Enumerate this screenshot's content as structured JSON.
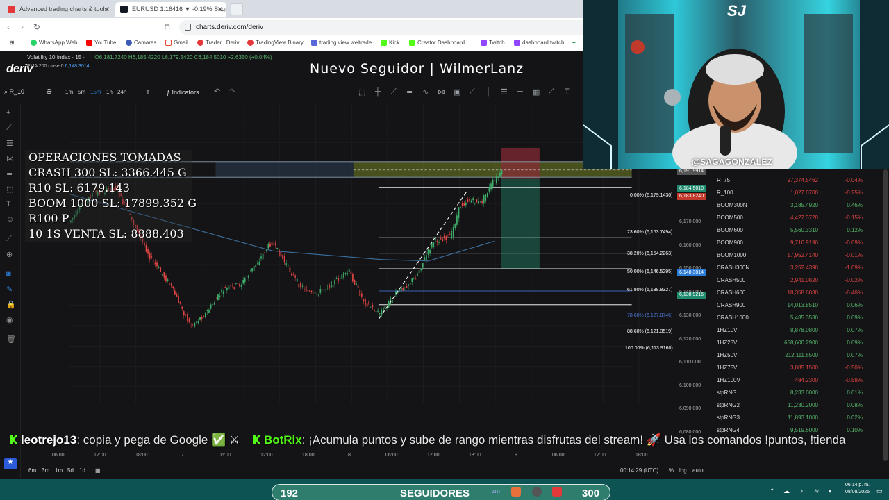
{
  "browser": {
    "tabs": [
      {
        "title": "Advanced trading charts & tools",
        "active": false
      },
      {
        "title": "EURUSD 1.16416 ▼ -0.19% Saga",
        "active": true
      }
    ],
    "url": "charts.deriv.com/deriv",
    "bookmarks": [
      "WhatsApp Web",
      "YouTube",
      "Camaras",
      "Gmail",
      "Trader | Deriv",
      "TradingView Binary",
      "trading view weltrade",
      "Kick",
      "Creator Dashboard |...",
      "Twitch",
      "dashboard twitch"
    ]
  },
  "app": {
    "logo": "deriv",
    "overlay_title": "Nuevo Seguidor | WilmerLanz",
    "symbol": "R_10",
    "timeframes": [
      "1m",
      "5m",
      "15m",
      "1h",
      "24h"
    ],
    "selected_timeframe": "15m",
    "indicators_label": "Indicators",
    "legend_title": "Volatility 10 Index · 15 ·",
    "legend_ohlc": "O6,181.7240 H6,185.4220 L6,179.5420 C6,184.5010 +2.6350 (+0.04%)",
    "legend_ema": "EMA 200 close 0",
    "legend_ema_value": "6,148.3014"
  },
  "operations": {
    "title": "OPERACIONES TOMADAS",
    "lines": [
      "CRASH 300 SL: 3366.445 G",
      "R10 SL: 6179.143",
      "BOOM 1000 SL: 17899.352 G",
      "R100 P",
      "10 1S VENTA SL: 8888.403"
    ]
  },
  "fib_levels": [
    {
      "label": "0.00% (6,179.1430)"
    },
    {
      "label": "23.60% (6,163.7494)"
    },
    {
      "label": "38.20% (6,154.2263)"
    },
    {
      "label": "50.00% (6,146.5295)"
    },
    {
      "label": "61.80% (6,138.8327)"
    },
    {
      "label": "78.60% (6,127.8746)"
    },
    {
      "label": "88.60% (6,121.3519)"
    },
    {
      "label": "100.00% (6,113.9160)"
    }
  ],
  "price_axis": [
    "6,170.000",
    "6,160.000",
    "6,150.000",
    "6,140.000",
    "6,130.000",
    "6,120.000",
    "6,110.000",
    "6,100.000",
    "6,090.000",
    "6,080.000"
  ],
  "price_tags": [
    {
      "text": "6,191.9914",
      "color": "#5a5a5a"
    },
    {
      "text": "6,184.5010",
      "color": "#1f8a6e"
    },
    {
      "text": "6,183.8240",
      "color": "#c0392b"
    },
    {
      "text": "6,148.3014",
      "color": "#2b7bd8"
    },
    {
      "text": "6,138.9216",
      "color": "#1f8a6e"
    }
  ],
  "time_axis": [
    "06:00",
    "12:00",
    "18:00",
    "7",
    "06:00",
    "12:00",
    "18:00",
    "8",
    "06:00",
    "12:00",
    "18:00",
    "9",
    "06:00",
    "12:00",
    "18:00"
  ],
  "bottom": {
    "periods": [
      "6m",
      "3m",
      "1m",
      "5d",
      "1d"
    ],
    "clock": "00:14:29 (UTC)",
    "opts": [
      "%",
      "log",
      "auto"
    ]
  },
  "watchlist": [
    {
      "name": "R_75",
      "price": "97,374.5462",
      "change": "-0.04%",
      "down": true
    },
    {
      "name": "R_100",
      "price": "1,027.0700",
      "change": "-0.25%",
      "down": true
    },
    {
      "name": "BOOM300N",
      "price": "3,185.4920",
      "change": "0.46%",
      "down": false
    },
    {
      "name": "BOOM500",
      "price": "4,427.3720",
      "change": "-0.15%",
      "down": true
    },
    {
      "name": "BOOM600",
      "price": "5,560.3310",
      "change": "0.12%",
      "down": false
    },
    {
      "name": "BOOM900",
      "price": "9,716.9190",
      "change": "-0.09%",
      "down": true
    },
    {
      "name": "BOOM1000",
      "price": "17,952.4140",
      "change": "-0.01%",
      "down": true
    },
    {
      "name": "CRASH300N",
      "price": "3,252.4390",
      "change": "-1.09%",
      "down": true
    },
    {
      "name": "CRASH500",
      "price": "2,941.0820",
      "change": "-0.02%",
      "down": true
    },
    {
      "name": "CRASH600",
      "price": "18,358.6030",
      "change": "-0.40%",
      "down": true
    },
    {
      "name": "CRASH900",
      "price": "14,013.8510",
      "change": "0.06%",
      "down": false
    },
    {
      "name": "CRASH1000",
      "price": "5,485.3530",
      "change": "0.09%",
      "down": false
    },
    {
      "name": "1HZ10V",
      "price": "8,878.0800",
      "change": "0.07%",
      "down": false
    },
    {
      "name": "1HZ25V",
      "price": "658,600.2900",
      "change": "0.09%",
      "down": false
    },
    {
      "name": "1HZ50V",
      "price": "212,111.6500",
      "change": "0.07%",
      "down": false
    },
    {
      "name": "1HZ75V",
      "price": "3,885.1500",
      "change": "-0.50%",
      "down": true
    },
    {
      "name": "1HZ100V",
      "price": "484.2300",
      "change": "-0.59%",
      "down": true
    },
    {
      "name": "stpRNG",
      "price": "8,233.0000",
      "change": "0.01%",
      "down": false
    },
    {
      "name": "stpRNG2",
      "price": "11,230.2000",
      "change": "0.08%",
      "down": false
    },
    {
      "name": "stpRNG3",
      "price": "11,893.1000",
      "change": "0.02%",
      "down": false
    },
    {
      "name": "stpRNG4",
      "price": "9,519.6000",
      "change": "0.10%",
      "down": false
    }
  ],
  "chat": {
    "user1": "leotrejo13",
    "msg1": ": copia y pega de Google ✅ ⚔",
    "user2": "BotRix",
    "msg2": ": ¡Acumula puntos y sube de rango mientras disfrutas del stream! 🚀 Usa los comandos !puntos, !tienda"
  },
  "webcam": {
    "tag": "@SAGAGONZALEZ",
    "logo": "SJ"
  },
  "followers": {
    "count": "192",
    "label": "SEGUIDORES",
    "goal": "300"
  },
  "system": {
    "time": "06:14 p. m.",
    "date": "08/08/2025"
  }
}
